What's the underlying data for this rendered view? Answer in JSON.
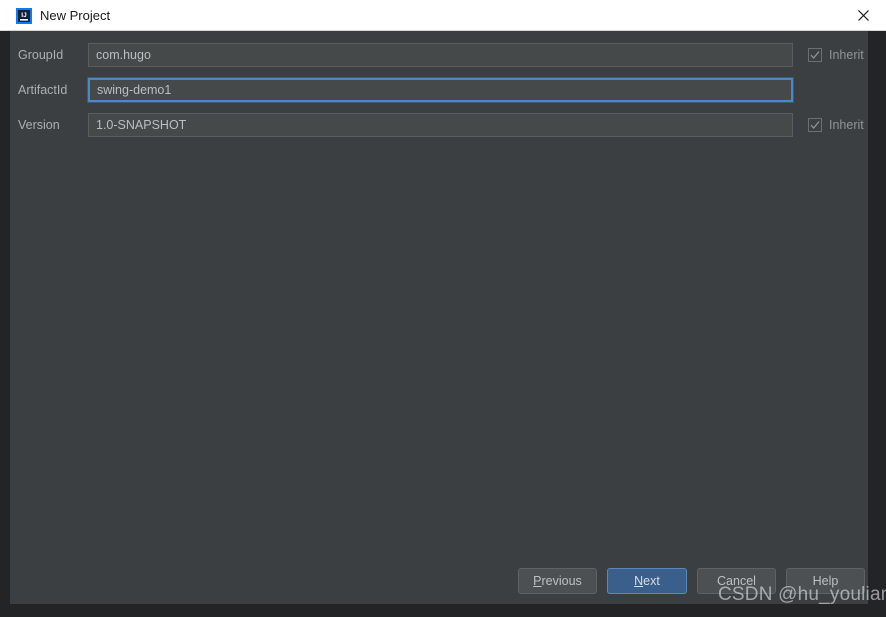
{
  "window": {
    "title": "New Project",
    "app_icon": "intellij-idea-icon",
    "close_icon": "close-icon",
    "panel_color": "#3c3f41",
    "titlebar_color": "#ffffff",
    "accent_color": "#4a88c7",
    "default_button_color": "#3a5f8a"
  },
  "form": {
    "rows": [
      {
        "label": "GroupId",
        "value": "com.hugo",
        "placeholder": "",
        "focused": false,
        "inherit": {
          "label": "Inherit",
          "checked": true,
          "enabled": false
        }
      },
      {
        "label": "ArtifactId",
        "value": "swing-demo1",
        "placeholder": "",
        "focused": true,
        "inherit": null
      },
      {
        "label": "Version",
        "value": "1.0-SNAPSHOT",
        "placeholder": "",
        "focused": false,
        "inherit": {
          "label": "Inherit",
          "checked": true,
          "enabled": false
        }
      }
    ]
  },
  "buttons": {
    "previous": {
      "label": "Previous",
      "mnemonic": "P",
      "default": false
    },
    "next": {
      "label": "Next",
      "mnemonic": "N",
      "default": true
    },
    "cancel": {
      "label": "Cancel",
      "mnemonic": "",
      "default": false
    },
    "help": {
      "label": "Help",
      "mnemonic": "",
      "default": false
    }
  },
  "watermark": {
    "text": "CSDN @hu_youliang"
  }
}
